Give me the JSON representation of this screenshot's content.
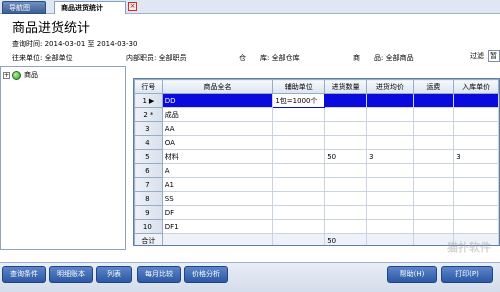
{
  "tabs": {
    "nav_label": "导航图",
    "active_label": "商品进货统计",
    "close_symbol": "×"
  },
  "header": {
    "title": "商品进货统计",
    "query_time_label": "查询时间:",
    "date_from": "2014-03-01",
    "to_word": "至",
    "date_to": "2014-03-30",
    "unit_label": "往来单位:",
    "unit_value": "全部单位",
    "staff_label": "内部职员:",
    "staff_value": "全部职员",
    "warehouse_label": "仓　　库:",
    "warehouse_value": "全部仓库",
    "goods_label": "商　　品:",
    "goods_value": "全部商品",
    "filter_label": "过滤",
    "filter_value": "暂"
  },
  "tree": {
    "root_label": "商品",
    "expand_symbol": "+"
  },
  "grid": {
    "columns": [
      "行号",
      "商品全名",
      "辅助单位",
      "进货数量",
      "进货均价",
      "运费",
      "入库单价"
    ],
    "rows": [
      {
        "no": "1",
        "marker": "▶",
        "name": "DD",
        "aux": "1包=1000个",
        "qty": "",
        "avg": "",
        "freight": "",
        "price": ""
      },
      {
        "no": "2",
        "marker": "*",
        "name": "成品",
        "aux": "",
        "qty": "",
        "avg": "",
        "freight": "",
        "price": ""
      },
      {
        "no": "3",
        "marker": "",
        "name": "AA",
        "aux": "",
        "qty": "",
        "avg": "",
        "freight": "",
        "price": ""
      },
      {
        "no": "4",
        "marker": "",
        "name": "OA",
        "aux": "",
        "qty": "",
        "avg": "",
        "freight": "",
        "price": ""
      },
      {
        "no": "5",
        "marker": "",
        "name": "材料",
        "aux": "",
        "qty": "50",
        "avg": "3",
        "freight": "",
        "price": "3"
      },
      {
        "no": "6",
        "marker": "",
        "name": "A",
        "aux": "",
        "qty": "",
        "avg": "",
        "freight": "",
        "price": ""
      },
      {
        "no": "7",
        "marker": "",
        "name": "A1",
        "aux": "",
        "qty": "",
        "avg": "",
        "freight": "",
        "price": ""
      },
      {
        "no": "8",
        "marker": "",
        "name": "SS",
        "aux": "",
        "qty": "",
        "avg": "",
        "freight": "",
        "price": ""
      },
      {
        "no": "9",
        "marker": "",
        "name": "DF",
        "aux": "",
        "qty": "",
        "avg": "",
        "freight": "",
        "price": ""
      },
      {
        "no": "10",
        "marker": "",
        "name": "DF1",
        "aux": "",
        "qty": "",
        "avg": "",
        "freight": "",
        "price": ""
      }
    ],
    "total_label": "合计",
    "total_qty": "50"
  },
  "buttons": {
    "query": "查询条件",
    "detail": "明细账本",
    "list": "列表",
    "monthly": "每月比较",
    "price_analysis": "价格分析",
    "help": "帮助(H)",
    "print": "打印(P)"
  },
  "watermark": "猫扑软件"
}
